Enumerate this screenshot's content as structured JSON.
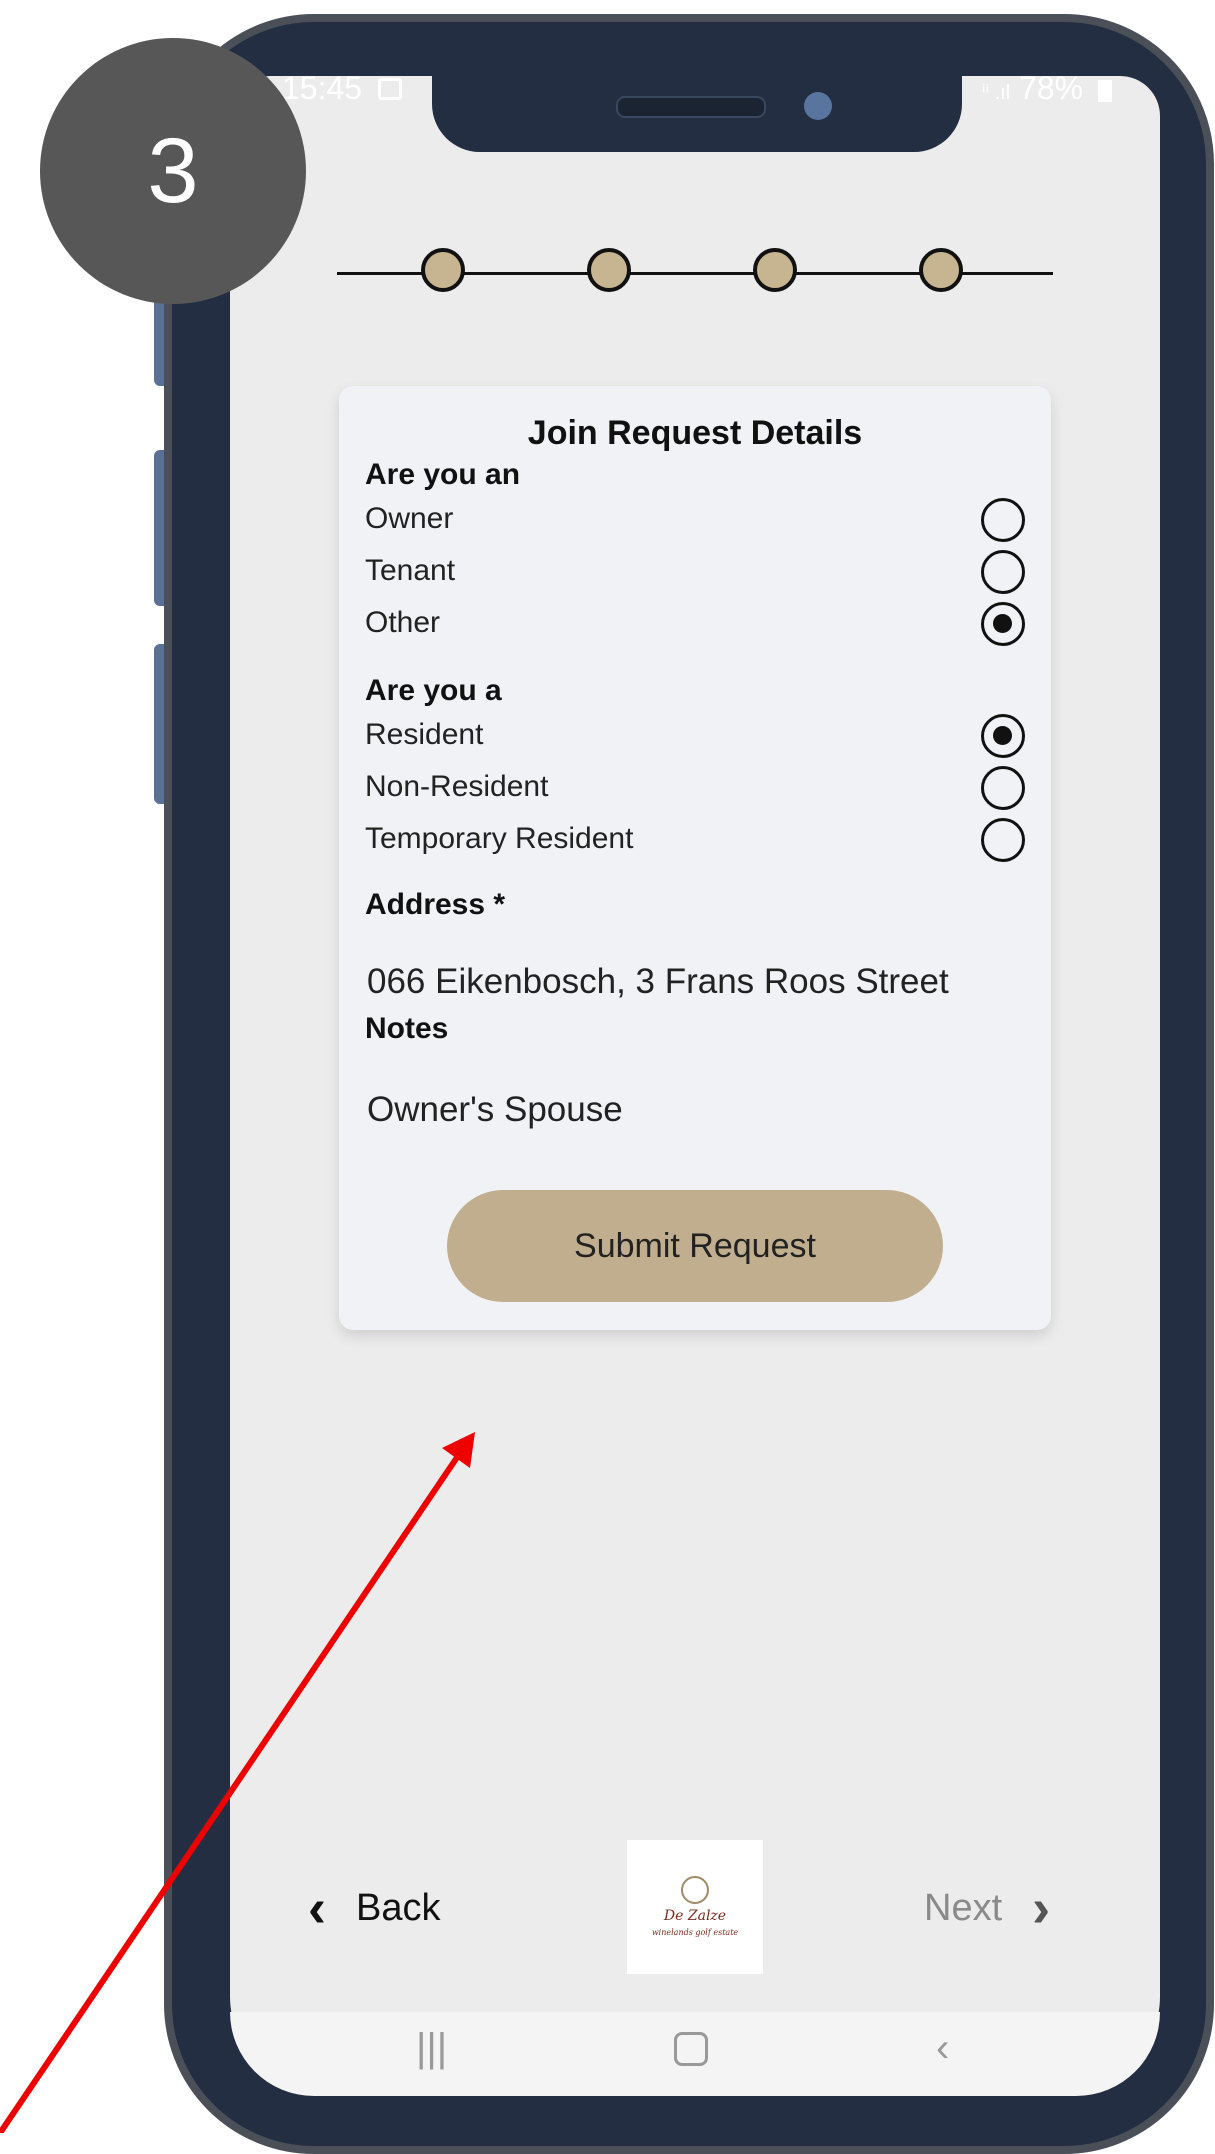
{
  "step_badge": "3",
  "status_bar": {
    "time": "15:45",
    "signal": "ⁱⁱ .ıl",
    "battery": "78%"
  },
  "stepper": {
    "steps": 4
  },
  "card": {
    "title": "Join Request Details",
    "q1": {
      "label": "Are you an",
      "options": [
        {
          "label": "Owner",
          "selected": false
        },
        {
          "label": "Tenant",
          "selected": false
        },
        {
          "label": "Other",
          "selected": true
        }
      ]
    },
    "q2": {
      "label": "Are you a",
      "options": [
        {
          "label": "Resident",
          "selected": true
        },
        {
          "label": "Non-Resident",
          "selected": false
        },
        {
          "label": "Temporary Resident",
          "selected": false
        }
      ]
    },
    "address_label": "Address *",
    "address_value": "066 Eikenbosch, 3 Frans Roos Street",
    "notes_label": "Notes",
    "notes_value": "Owner's Spouse",
    "submit_label": "Submit Request"
  },
  "nav": {
    "back_label": "Back",
    "next_label": "Next",
    "logo_script": "De Zalze",
    "logo_sub": "winelands golf estate"
  },
  "colors": {
    "phone_frame": "#232e42",
    "accent_beige": "#c1ae8e",
    "annotation_arrow": "#ee0000"
  },
  "icons": {
    "back": "chevron-left-icon",
    "next": "chevron-right-icon",
    "recents": "recents-icon",
    "home": "home-icon",
    "sys_back": "system-back-icon"
  }
}
